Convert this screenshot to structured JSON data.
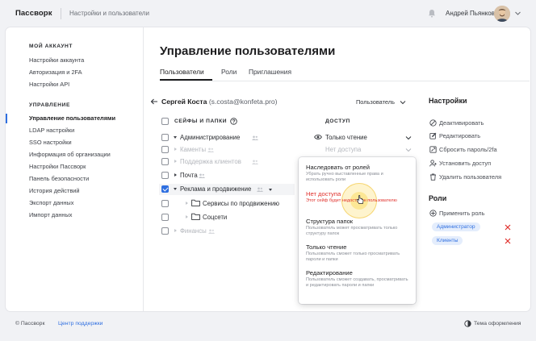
{
  "header": {
    "logo": "Пассворк",
    "breadcrumb": "Настройки и пользователи",
    "user_name": "Андрей Пьянков"
  },
  "sidebar": {
    "account_heading": "МОЙ АККАУНТ",
    "account_items": [
      "Настройки аккаунта",
      "Авторизация и 2FA",
      "Настройки API"
    ],
    "admin_heading": "УПРАВЛЕНИЕ",
    "admin_items": [
      "Управление пользователями",
      "LDAP настройки",
      "SSO настройки",
      "Информация об организации",
      "Настройки Пассворк",
      "Панель безопасности",
      "История действий",
      "Экспорт данных",
      "Импорт данных"
    ],
    "active_index": 0
  },
  "main": {
    "title": "Управление пользователями",
    "tabs": [
      "Пользователи",
      "Роли",
      "Приглашения"
    ],
    "active_tab": 0
  },
  "user": {
    "name": "Сергей Коста",
    "email": "(s.costa@konfeta.pro)",
    "role_select": "Пользователь"
  },
  "table": {
    "col_safes": "СЕЙФЫ И ПАПКИ",
    "col_access": "ДОСТУП",
    "rows": [
      {
        "name": "Администрирование",
        "access": "Только чтение",
        "checked": false,
        "faint": false
      },
      {
        "name": "Каменты",
        "access": "Нет доступа",
        "checked": false,
        "faint": true
      },
      {
        "name": "Поддержка клиентов",
        "access": "",
        "checked": false,
        "faint": true
      },
      {
        "name": "Почта",
        "access": "",
        "checked": false,
        "faint": false
      },
      {
        "name": "Реклама и продвижение",
        "access": "",
        "checked": true,
        "faint": false
      },
      {
        "name": "Сервисы по продвижению",
        "access": "",
        "checked": false,
        "faint": false
      },
      {
        "name": "Соцсети",
        "access": "",
        "checked": false,
        "faint": false
      },
      {
        "name": "Финансы",
        "access": "",
        "checked": false,
        "faint": true
      }
    ]
  },
  "dropdown": {
    "options": [
      {
        "title": "Наследовать от ролей",
        "desc": "Убрать ручно выставленные права и использовать роли"
      },
      {
        "title": "Нет доступа",
        "desc": "Этот сейф будет недоступен пользователю"
      },
      {
        "title": "Структура папок",
        "desc": "Пользователь может просматривать только структуру папок"
      },
      {
        "title": "Только чтение",
        "desc": "Пользователь сможет только просматривать пароли и папки"
      },
      {
        "title": "Редактирование",
        "desc": "Пользователь сможет создавать, просматривать и редактировать пароли и папки"
      }
    ]
  },
  "settings": {
    "title": "Настройки",
    "actions": [
      "Деактивировать",
      "Редактировать",
      "Сбросить пароль/2fa",
      "Установить доступ",
      "Удалить пользователя"
    ],
    "roles_title": "Роли",
    "apply_role": "Применить роль",
    "roles": [
      "Администратор",
      "Клиенты"
    ]
  },
  "footer": {
    "copyright": "© Пассворк",
    "support": "Центр поддержки",
    "theme": "Тема оформления"
  },
  "colors": {
    "accent": "#2f6fe0",
    "danger": "#e0302b",
    "hover": "#fad650"
  }
}
